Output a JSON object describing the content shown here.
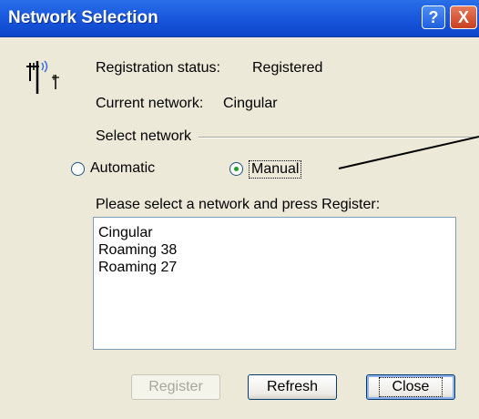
{
  "window": {
    "title": "Network Selection",
    "help_glyph": "?",
    "close_glyph": "X"
  },
  "status": {
    "registration_label": "Registration status:",
    "registration_value": "Registered",
    "network_label": "Current network:",
    "network_value": "Cingular"
  },
  "select_network": {
    "group_label": "Select network",
    "options": [
      {
        "label": "Automatic",
        "selected": false
      },
      {
        "label": "Manual",
        "selected": true
      }
    ]
  },
  "network_list": {
    "prompt": "Please select a network and press Register:",
    "items": [
      "Cingular",
      "Roaming 38",
      "Roaming 27"
    ]
  },
  "buttons": {
    "register": "Register",
    "refresh": "Refresh",
    "close": "Close"
  },
  "colors": {
    "titlebar": "#1c5be0",
    "dialog_bg": "#ece9d8",
    "radio_dot": "#21a121"
  },
  "icons": {
    "app": "antenna-icon"
  }
}
